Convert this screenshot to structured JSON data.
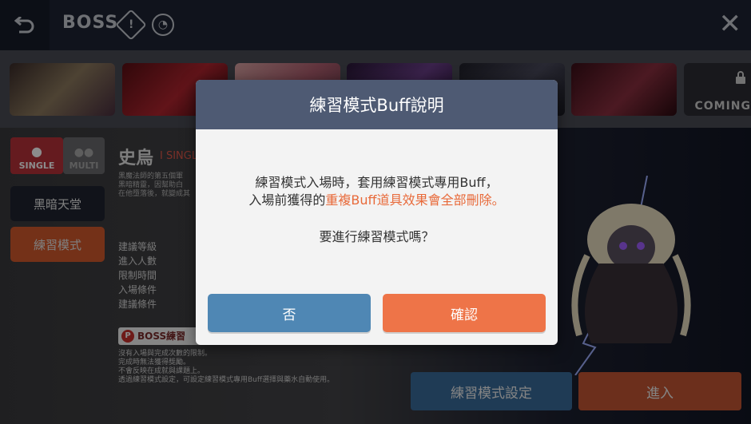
{
  "topbar": {
    "back_icon": "back-arrow-icon",
    "title": "BOSS",
    "info_icon": "info-diamond-icon",
    "gauge_icon": "gauge-icon",
    "close_icon": "close-icon"
  },
  "boss_strip": {
    "cards": [
      {
        "name": "boss-card-1",
        "color": "#6b5b4b"
      },
      {
        "name": "boss-card-2",
        "color": "#8a1f26"
      },
      {
        "name": "boss-card-3",
        "color": "#b26a6a"
      },
      {
        "name": "boss-card-4",
        "color": "#5b3a70"
      },
      {
        "name": "boss-card-5",
        "color": "#3b3b4a"
      },
      {
        "name": "boss-card-6",
        "color": "#5a1f2a"
      }
    ],
    "coming_label": "COMING"
  },
  "modes": {
    "single": "SINGLE",
    "multi": "MULTI"
  },
  "side_buttons": {
    "dark_heaven": "黑暗天堂",
    "practice": "練習模式"
  },
  "boss": {
    "name": "史烏",
    "sub": "I SINGL",
    "desc": [
      "黑魔法師的第五個軍",
      "黑暗精靈，因幫助白",
      "在他墮落後，就變成其"
    ],
    "stats": [
      "建議等級",
      "進入人數",
      "限制時間",
      "入場條件",
      "建議條件"
    ],
    "badge": "BOSS練習",
    "rules": [
      "沒有入場與完成次數的限制。",
      "完成時無法獲得獎勵。",
      "不會反映在成就與課題上。",
      "透過練習模式設定，可設定練習模式專用Buff選擇與藥水自動使用。"
    ]
  },
  "bottom": {
    "settings": "練習模式設定",
    "enter": "進入"
  },
  "dialog": {
    "title": "練習模式Buff說明",
    "line1": "練習模式入場時，套用練習模式專用Buff，",
    "line2_plain": "入場前獲得的",
    "line2_highlight": "重複Buff道具效果會全部刪除。",
    "question": "要進行練習模式嗎？",
    "no": "否",
    "confirm": "確認"
  },
  "colors": {
    "header": "#4e5a73",
    "no_button": "#4f87b4",
    "confirm_button": "#ee7448",
    "highlight": "#e86a3a",
    "accent_red": "#c9302c"
  }
}
